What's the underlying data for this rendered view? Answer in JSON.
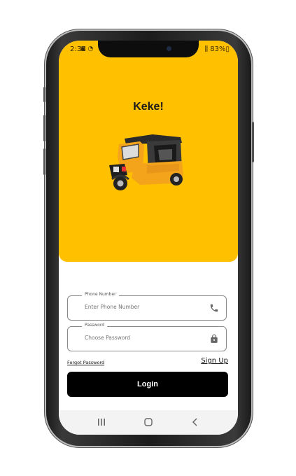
{
  "status_bar": {
    "time": "2:38",
    "icons": "▣ ◔",
    "right": "⫼ 83%▯"
  },
  "app": {
    "title": "Keke!",
    "illustration": "auto-rickshaw-illustration"
  },
  "form": {
    "phone": {
      "label": "Phone Number",
      "placeholder": "Enter Phone Number",
      "icon": "phone-icon"
    },
    "password": {
      "label": "Password",
      "placeholder": "Choose Password",
      "icon": "lock-icon"
    },
    "forgot_label": "Forgot Password",
    "signup_label": "Sign Up",
    "login_label": "Login"
  },
  "nav_bar": {
    "items": [
      "recents-icon",
      "home-icon",
      "back-icon"
    ]
  },
  "colors": {
    "accent": "#ffc000",
    "button": "#000000",
    "button_text": "#ffffff"
  }
}
